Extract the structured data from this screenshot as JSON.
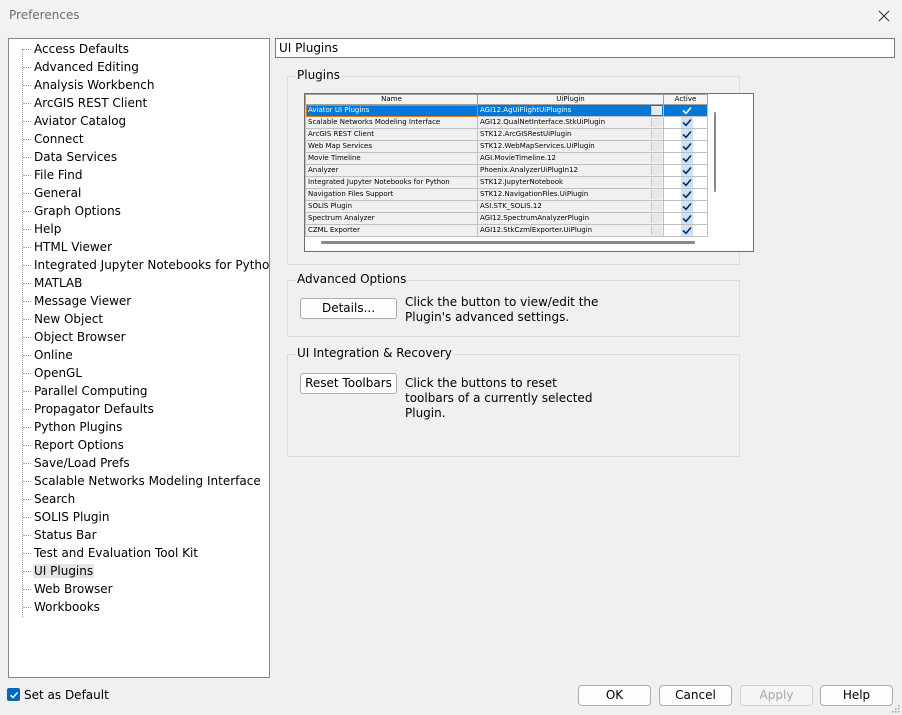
{
  "window": {
    "title": "Preferences"
  },
  "tree": {
    "items": [
      "Access Defaults",
      "Advanced Editing",
      "Analysis Workbench",
      "ArcGIS REST Client",
      "Aviator Catalog",
      "Connect",
      "Data Services",
      "File Find",
      "General",
      "Graph Options",
      "Help",
      "HTML Viewer",
      "Integrated Jupyter Notebooks for Python",
      "MATLAB",
      "Message Viewer",
      "New Object",
      "Object Browser",
      "Online",
      "OpenGL",
      "Parallel Computing",
      "Propagator Defaults",
      "Python Plugins",
      "Report Options",
      "Save/Load Prefs",
      "Scalable Networks Modeling Interface",
      "Search",
      "SOLIS Plugin",
      "Status Bar",
      "Test and Evaluation Tool Kit",
      "UI Plugins",
      "Web Browser",
      "Workbooks"
    ],
    "selected": "UI Plugins"
  },
  "main": {
    "section_title": "UI Plugins",
    "plugins_group": {
      "label": "Plugins",
      "columns": [
        "Name",
        "UiPlugin",
        "Active"
      ],
      "rows": [
        {
          "name": "Aviator UI Plugins",
          "plugin": "AGI12.AgUiFlightUiPlugins",
          "active": true,
          "selected": true
        },
        {
          "name": "Scalable Networks Modeling Interface",
          "plugin": "AGI12.QualNetInterface.StkUiPlugin",
          "active": true
        },
        {
          "name": "ArcGIS REST Client",
          "plugin": "STK12.ArcGISRestUiPlugin",
          "active": true
        },
        {
          "name": "Web Map Services",
          "plugin": "STK12.WebMapServices.UiPlugin",
          "active": true
        },
        {
          "name": "Movie Timeline",
          "plugin": "AGI.MovieTimeline.12",
          "active": true
        },
        {
          "name": "Analyzer",
          "plugin": "Phoenix.AnalyzerUiPlugIn12",
          "active": true
        },
        {
          "name": "Integrated Jupyter Notebooks for Python",
          "plugin": "STK12.JupyterNotebook",
          "active": true
        },
        {
          "name": "Navigation Files Support",
          "plugin": "STK12.NavigationFiles.UiPlugin",
          "active": true
        },
        {
          "name": "SOLIS Plugin",
          "plugin": "ASI.STK_SOLIS.12",
          "active": true
        },
        {
          "name": "Spectrum Analyzer",
          "plugin": "AGI12.SpectrumAnalyzerPlugin",
          "active": true
        },
        {
          "name": "CZML Exporter",
          "plugin": "AGI12.StkCzmlExporter.UiPlugin",
          "active": true
        }
      ]
    },
    "advanced_group": {
      "label": "Advanced Options",
      "button": "Details...",
      "description": [
        "Click the button to view/edit the",
        "Plugin's advanced settings."
      ]
    },
    "recovery_group": {
      "label": "UI Integration & Recovery",
      "button": "Reset Toolbars",
      "description": [
        "Click the buttons to reset",
        "toolbars of a currently selected",
        "Plugin."
      ]
    }
  },
  "footer": {
    "set_default_label": "Set as Default",
    "set_default_checked": true,
    "ok": "OK",
    "cancel": "Cancel",
    "apply": "Apply",
    "help": "Help"
  },
  "colors": {
    "accent": "#0078d7",
    "checkbox": "#0067c0",
    "selected_outline": "#e07b10"
  }
}
